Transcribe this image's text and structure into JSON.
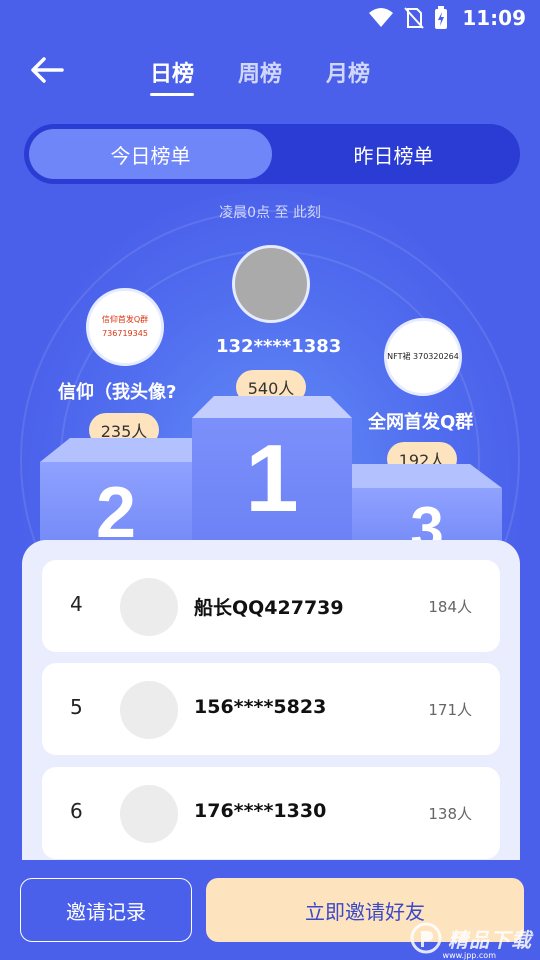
{
  "status": {
    "time": "11:09"
  },
  "tabs": [
    {
      "label": "日榜",
      "active": true
    },
    {
      "label": "周榜",
      "active": false
    },
    {
      "label": "月榜",
      "active": false
    }
  ],
  "segment": {
    "today": "今日榜单",
    "yesterday": "昨日榜单"
  },
  "subtitle": "凌晨0点 至 此刻",
  "podium": {
    "first": {
      "rank": "1",
      "name": "132****1383",
      "count": "540人"
    },
    "second": {
      "rank": "2",
      "name": "信仰（我头像?",
      "count": "235人",
      "avatar_line1": "信仰首发Q群",
      "avatar_line2": "736719345"
    },
    "third": {
      "rank": "3",
      "name": "全网首发Q群",
      "count": "192人",
      "avatar_text": "NFT裙 370320264"
    }
  },
  "list": [
    {
      "rank": "4",
      "name": "船长QQ427739",
      "count": "184人"
    },
    {
      "rank": "5",
      "name": "156****5823",
      "count": "171人"
    },
    {
      "rank": "6",
      "name": "176****1330",
      "count": "138人"
    }
  ],
  "buttons": {
    "record": "邀请记录",
    "invite": "立即邀请好友"
  },
  "watermark": {
    "text": "精品下载",
    "url": "www.jpp.com"
  },
  "colors": {
    "background": "#4a5fea",
    "accent_pill": "#fde3be",
    "segment_bg": "#2a3cd3",
    "segment_active": "#6f86f8"
  }
}
